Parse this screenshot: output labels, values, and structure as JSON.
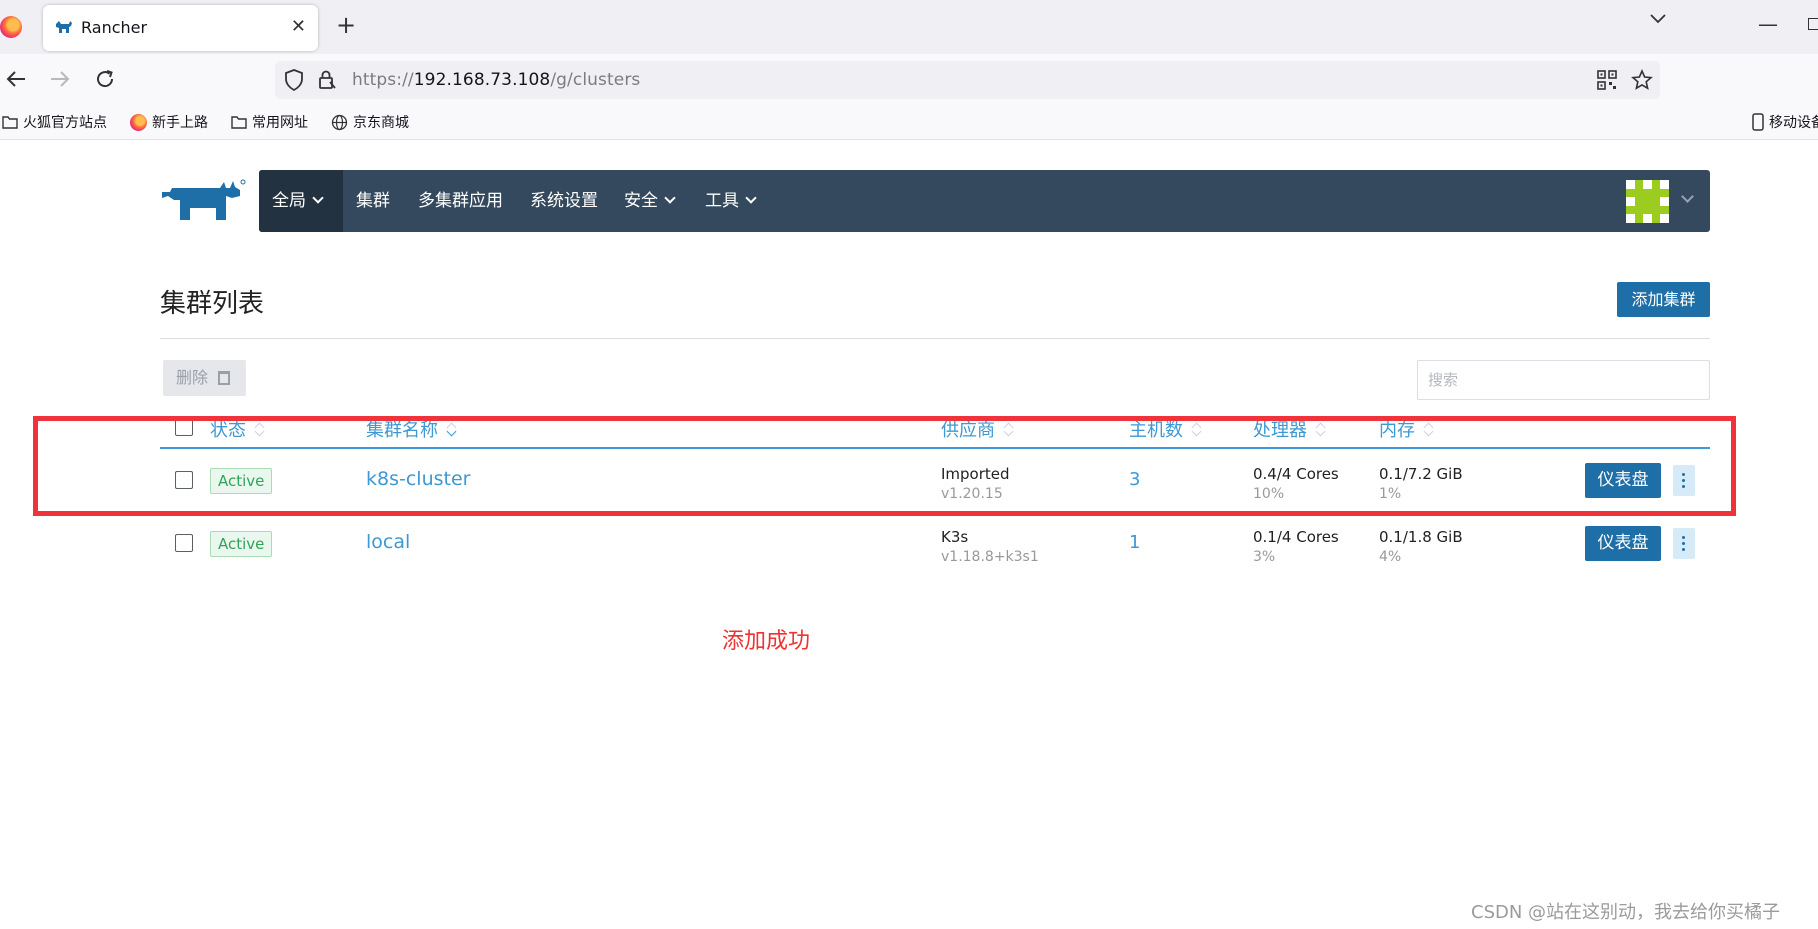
{
  "browser": {
    "tab_title": "Rancher",
    "url_scheme": "https://",
    "url_host": "192.168.73.108",
    "url_path": "/g/clusters",
    "bookmarks": [
      "火狐官方站点",
      "新手上路",
      "常用网址",
      "京东商城"
    ],
    "mobile_bookmark": "移动设备"
  },
  "nav": {
    "global": "全局",
    "items": [
      "集群",
      "多集群应用",
      "系统设置",
      "安全",
      "工具"
    ]
  },
  "page": {
    "title": "集群列表",
    "add_button": "添加集群",
    "delete_button": "删除",
    "search_placeholder": "搜索"
  },
  "table": {
    "headers": [
      "状态",
      "集群名称",
      "供应商",
      "主机数",
      "处理器",
      "内存"
    ],
    "rows": [
      {
        "state": "Active",
        "name": "k8s-cluster",
        "provider": "Imported",
        "version": "v1.20.15",
        "hosts": "3",
        "cpu": "0.4/4 Cores",
        "cpu_pct": "10%",
        "mem": "0.1/7.2 GiB",
        "mem_pct": "1%",
        "action": "仪表盘"
      },
      {
        "state": "Active",
        "name": "local",
        "provider": "K3s",
        "version": "v1.18.8+k3s1",
        "hosts": "1",
        "cpu": "0.1/4 Cores",
        "cpu_pct": "3%",
        "mem": "0.1/1.8 GiB",
        "mem_pct": "4%",
        "action": "仪表盘"
      }
    ]
  },
  "annotation": "添加成功",
  "watermark": "CSDN @站在这别动，我去给你买橘子",
  "colors": {
    "nav_bg": "#34495e",
    "nav_active": "#233240",
    "primary": "#1e6ea7",
    "link": "#3d98d3",
    "active_badge": "#32a35a",
    "highlight": "#f0333a"
  }
}
